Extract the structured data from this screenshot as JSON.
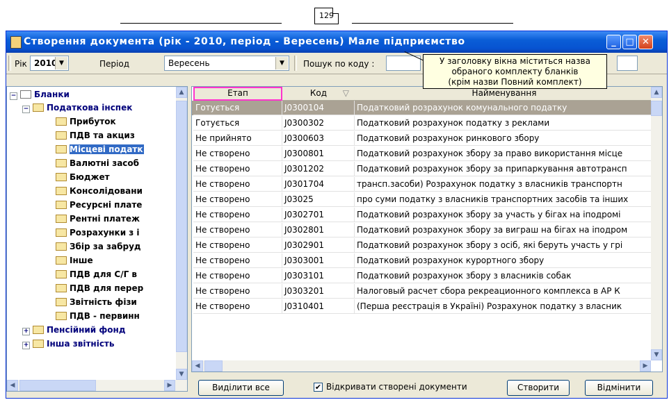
{
  "page_number": "129",
  "window": {
    "title": "Створення документа (рік - 2010, період - Вересень)  Мале підприємство",
    "buttons": {
      "minimize": "_",
      "maximize": "□",
      "close": "✕"
    }
  },
  "tooltip": {
    "line1": "У заголовку вікна міститься назва",
    "line2": "обраного комплекту бланків",
    "line3": "(крім назви Повний комплект)"
  },
  "toolbar": {
    "year_label": "Рік",
    "year_value": "2010",
    "period_label": "Період",
    "period_value": "Вересень",
    "search_label": "Пошук по коду :"
  },
  "tree": {
    "root": "Бланки",
    "items": [
      "Податкова інспек",
      "Прибуток",
      "ПДВ та акциз",
      "Місцеві податк",
      "Валютні засоб",
      "Бюджет",
      "Консолідовани",
      "Ресурсні плате",
      "Рентні платеж",
      "Розрахунки з і",
      "Збір за забруд",
      "Інше",
      "ПДВ для С/Г в",
      "ПДВ для перер",
      "Звітність фізи",
      "ПДВ - первинн",
      "Пенсійний фонд",
      "Інша звітність"
    ]
  },
  "grid": {
    "columns": [
      "Етап",
      "Код",
      "Найменування"
    ],
    "rows": [
      [
        "Готується",
        "J0300104",
        "Податковий розрахунок комунального податку"
      ],
      [
        "Готується",
        "J0300302",
        "Податковий розрахунок податку з реклами"
      ],
      [
        "Не прийнято",
        "J0300603",
        "Податковий розрахунок ринкового збору"
      ],
      [
        "Не створено",
        "J0300801",
        "Податковий розрахунок збору за право використання місце"
      ],
      [
        "Не створено",
        "J0301202",
        "Податковий розрахунок збору за припаркування автотрансп"
      ],
      [
        "Не створено",
        "J0301704",
        "трансп.засоби)  Розрахунок податку з власників транспортн"
      ],
      [
        "Не створено",
        "J03025",
        "про суми податку з власників транспортних засобів та інших"
      ],
      [
        "Не створено",
        "J0302701",
        "Податковий розрахунок збору за участь у бігах на іподромі"
      ],
      [
        "Не створено",
        "J0302801",
        "Податковий розрахунок збору за виграш на бігах на іподром"
      ],
      [
        "Не створено",
        "J0302901",
        "Податковий розрахунок збору з осіб, які беруть участь у грі"
      ],
      [
        "Не створено",
        "J0303001",
        "Податковий розрахунок курортного збору"
      ],
      [
        "Не створено",
        "J0303101",
        "Податковий розрахунок збору з власників собак"
      ],
      [
        "Не створено",
        "J0303201",
        "Налоговый расчет сбора рекреационного комплекса в АР К"
      ],
      [
        "Не створено",
        "J0310401",
        "(Перша реєстрація в Україні) Розрахунок податку з власник"
      ]
    ]
  },
  "footer": {
    "select_all": "Виділити все",
    "open_created_label": "Відкривати створені документи",
    "create": "Створити",
    "cancel": "Відмінити"
  }
}
